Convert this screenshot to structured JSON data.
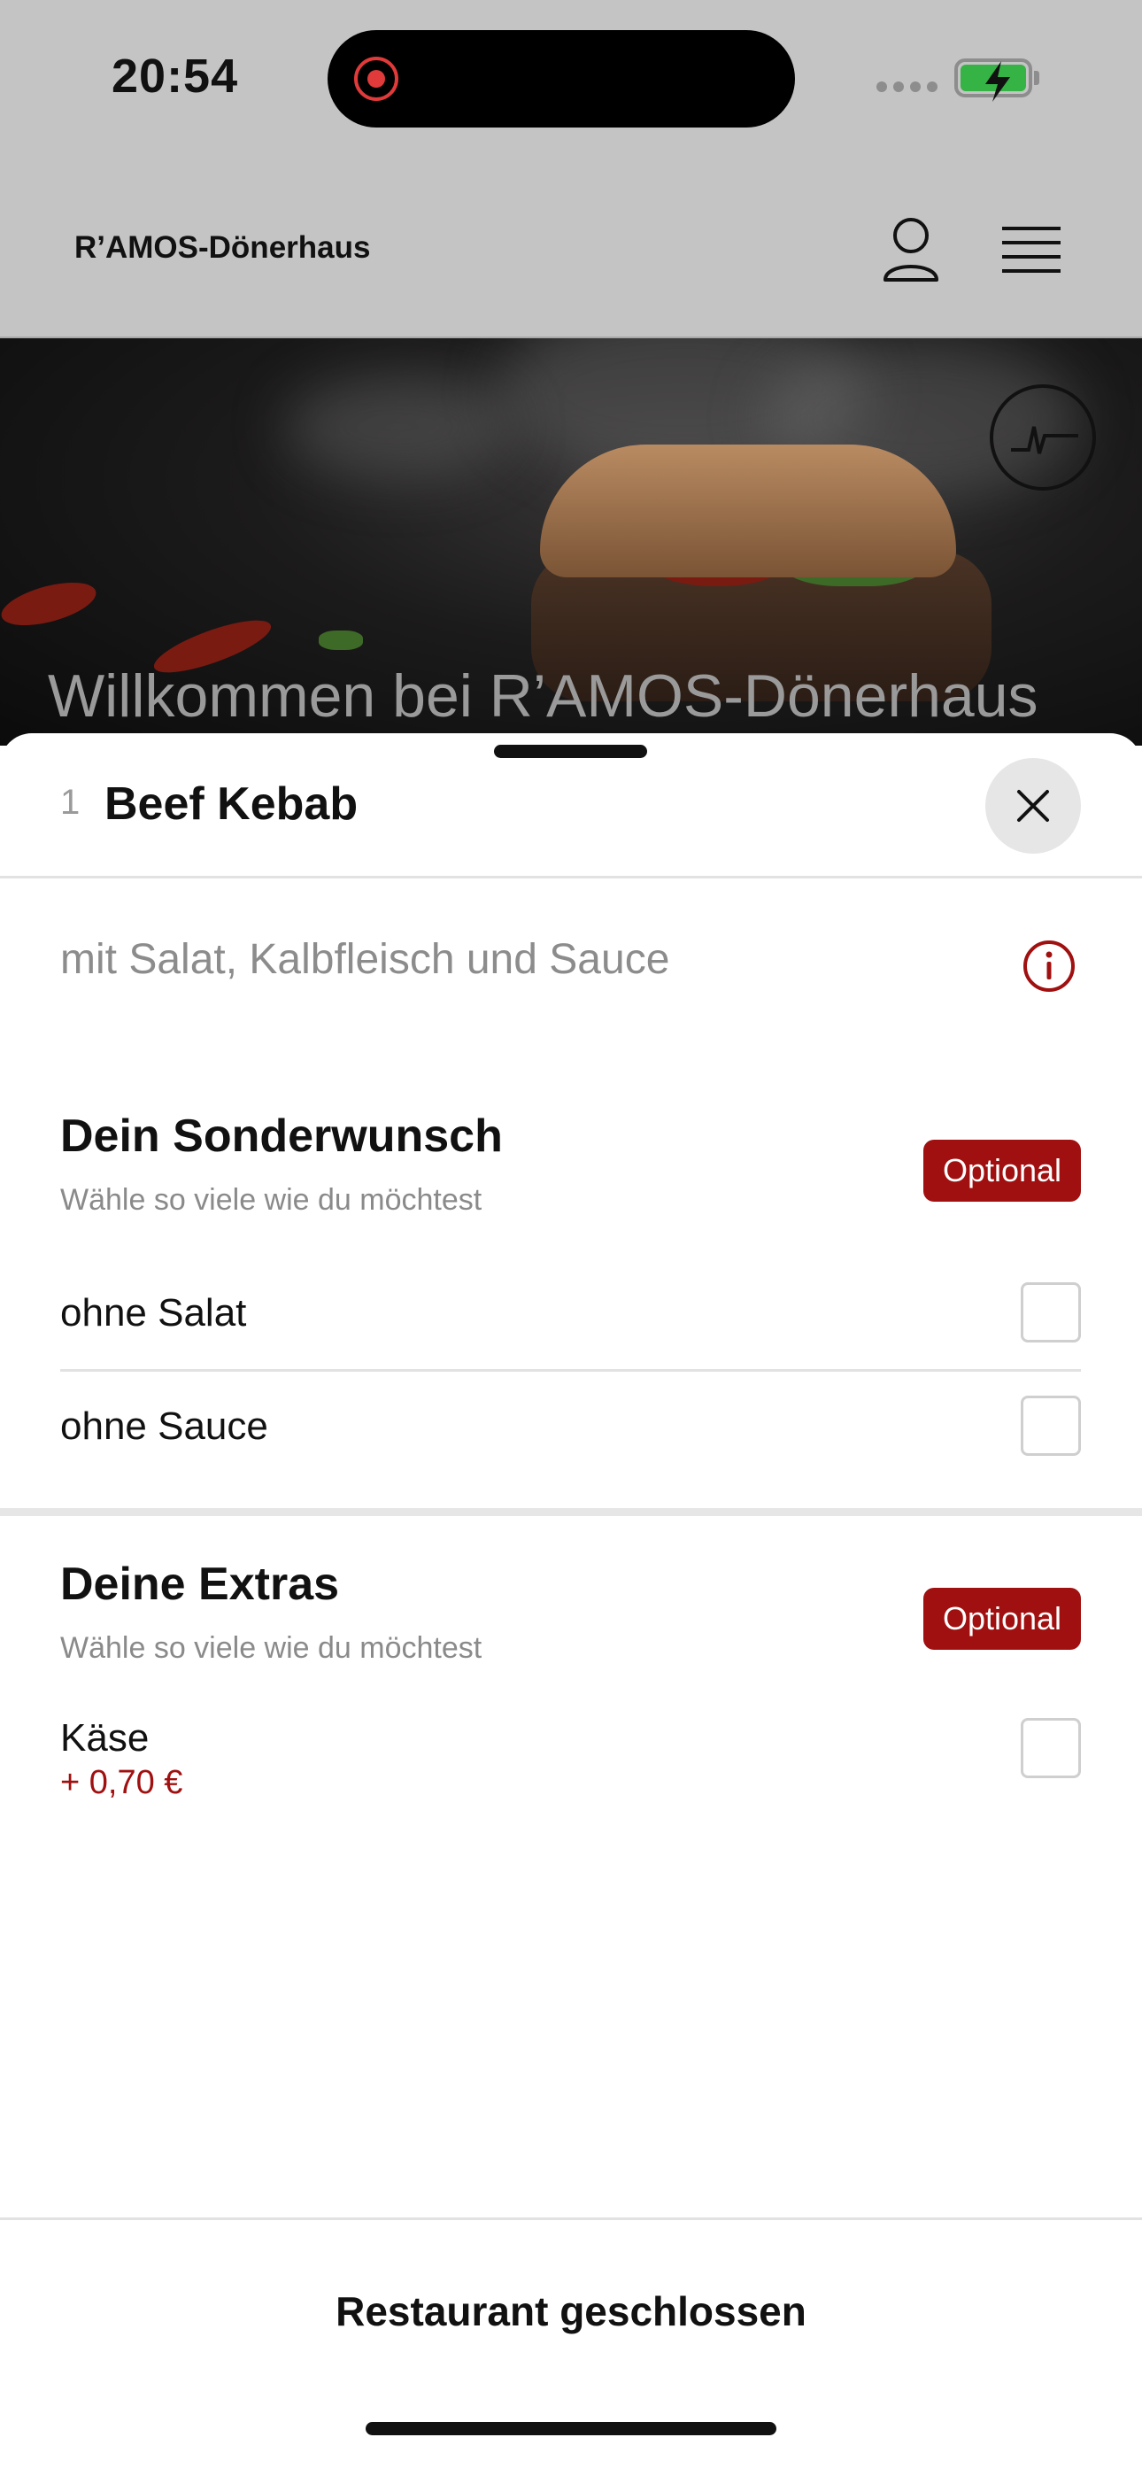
{
  "status_bar": {
    "time": "20:54"
  },
  "header": {
    "brand": "R’AMOS-Dönerhaus"
  },
  "hero": {
    "title": "Willkommen bei R’AMOS-Dönerhaus"
  },
  "sheet": {
    "quantity": "1",
    "title": "Beef Kebab",
    "description": "mit Salat, Kalbfleisch und Sauce",
    "sections": [
      {
        "title": "Dein Sonderwunsch",
        "subtitle": "Wähle so viele wie du möchtest",
        "badge": "Optional",
        "options": [
          {
            "label": "ohne Salat",
            "checked": false
          },
          {
            "label": "ohne Sauce",
            "checked": false
          }
        ]
      },
      {
        "title": "Deine Extras",
        "subtitle": "Wähle so viele wie du möchtest",
        "badge": "Optional",
        "options": [
          {
            "label": "Käse",
            "price": "+ 0,70 €",
            "checked": false
          }
        ]
      }
    ],
    "footer": "Restaurant geschlossen"
  },
  "colors": {
    "accent": "#a01010",
    "overlay": "#c4c4c4",
    "battery": "#35b345"
  }
}
